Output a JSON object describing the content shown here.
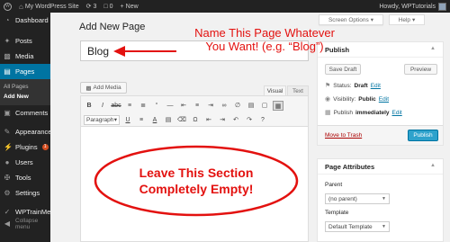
{
  "admin_bar": {
    "site_name": "My WordPress Site",
    "updates_count": "3",
    "comments_count": "0",
    "new_label": "New",
    "greeting": "Howdy, WPTutorials"
  },
  "sidebar": {
    "items": [
      {
        "label": "Dashboard",
        "icon": "dashboard-icon"
      },
      {
        "label": "Posts",
        "icon": "pin-icon"
      },
      {
        "label": "Media",
        "icon": "media-icon"
      },
      {
        "label": "Pages",
        "icon": "page-icon"
      },
      {
        "label": "Comments",
        "icon": "comment-icon"
      },
      {
        "label": "Appearance",
        "icon": "paintbrush-icon"
      },
      {
        "label": "Plugins",
        "icon": "plug-icon",
        "badge": "1"
      },
      {
        "label": "Users",
        "icon": "user-icon"
      },
      {
        "label": "Tools",
        "icon": "wrench-icon"
      },
      {
        "label": "Settings",
        "icon": "settings-icon"
      },
      {
        "label": "WPTrainMe",
        "icon": "wptrainme-icon"
      },
      {
        "label": "Collapse menu",
        "icon": "collapse-icon"
      }
    ],
    "submenu": {
      "all_pages": "All Pages",
      "add_new": "Add New"
    }
  },
  "header": {
    "title": "Add New Page",
    "screen_options": "Screen Options",
    "help": "Help"
  },
  "editor": {
    "title_value": "Blog",
    "add_media": "Add Media",
    "tab_visual": "Visual",
    "tab_text": "Text",
    "format_value": "Paragraph"
  },
  "publish": {
    "title": "Publish",
    "save_draft": "Save Draft",
    "preview": "Preview",
    "status_label": "Status:",
    "status_value": "Draft",
    "visibility_label": "Visibility:",
    "visibility_value": "Public",
    "publish_label": "Publish",
    "publish_value": "immediately",
    "edit": "Edit",
    "move_to_trash": "Move to Trash",
    "publish_button": "Publish"
  },
  "page_attributes": {
    "title": "Page Attributes",
    "parent_label": "Parent",
    "parent_value": "(no parent)",
    "template_label": "Template",
    "template_value": "Default Template"
  },
  "annotations": {
    "name_line1": "Name This Page Whatever",
    "name_line2": "You Want! (e.g. “Blog”)",
    "empty_line1": "Leave This Section",
    "empty_line2": "Completely Empty!",
    "color": "#e3110f"
  },
  "colors": {
    "admin_dark": "#222222",
    "current_menu": "#0074a2",
    "publish_button": "#2ea2cc",
    "trash_link": "#aa0000"
  }
}
